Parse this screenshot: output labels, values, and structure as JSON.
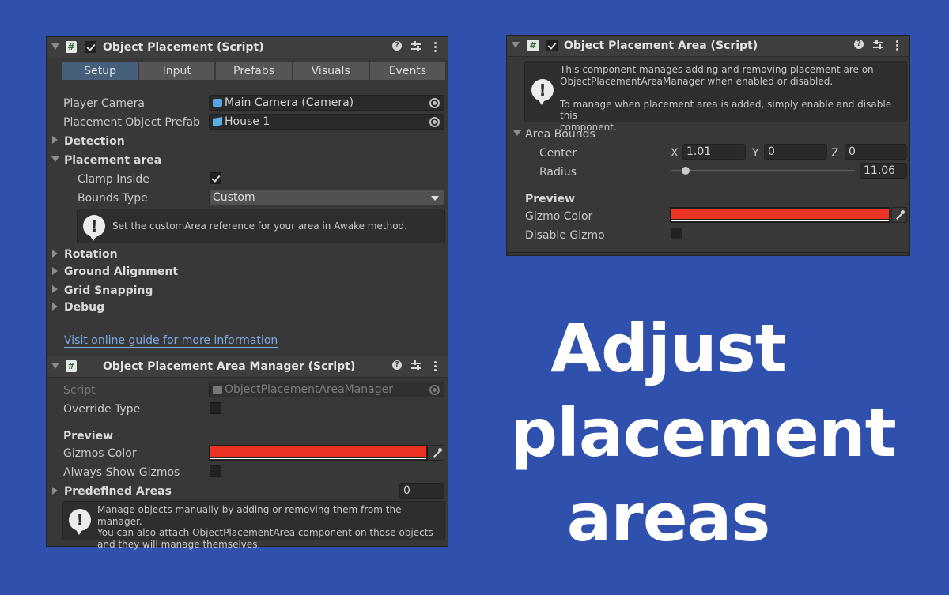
{
  "headline": {
    "line1": "Adjust",
    "line2": "placement",
    "line3": "areas"
  },
  "colors": {
    "background": "#2f50ad",
    "panel": "#383838",
    "gizmo_color": "#ea3323",
    "active_tab": "#46607c",
    "link": "#7fa7e6"
  },
  "left_panel": {
    "object_placement": {
      "title": "Object Placement (Script)",
      "script_icon": "#",
      "tabs": [
        {
          "label": "Setup",
          "active": true
        },
        {
          "label": "Input",
          "active": false
        },
        {
          "label": "Prefabs",
          "active": false
        },
        {
          "label": "Visuals",
          "active": false
        },
        {
          "label": "Events",
          "active": false
        }
      ],
      "player_camera_label": "Player Camera",
      "player_camera_value": "Main Camera (Camera)",
      "placement_prefab_label": "Placement Object Prefab",
      "placement_prefab_value": "House 1",
      "detection_label": "Detection",
      "placement_area_label": "Placement area",
      "clamp_inside_label": "Clamp Inside",
      "clamp_inside_checked": true,
      "bounds_type_label": "Bounds Type",
      "bounds_type_value": "Custom",
      "help_message": "Set the customArea reference for your area in Awake method.",
      "rotation_label": "Rotation",
      "ground_alignment_label": "Ground Alignment",
      "grid_snapping_label": "Grid Snapping",
      "debug_label": "Debug",
      "guide_link": "Visit online guide for more information"
    },
    "area_manager": {
      "title": "Object Placement Area Manager (Script)",
      "script_icon": "#",
      "script_label": "Script",
      "script_value": "ObjectPlacementAreaManager",
      "override_type_label": "Override Type",
      "preview_label": "Preview",
      "gizmos_color_label": "Gizmos Color",
      "always_show_gizmos_label": "Always Show Gizmos",
      "predefined_areas_label": "Predefined Areas",
      "predefined_areas_value": "0",
      "help_message": "Manage objects manually by adding or removing them from the manager.\nYou can also attach ObjectPlacementArea component on those objects\nand they will manage themselves."
    }
  },
  "right_panel": {
    "title": "Object Placement Area (Script)",
    "script_icon": "#",
    "help_message": "This component manages adding and removing placement are on\nObjectPlacementAreaManager when enabled or disabled.\n\nTo manage when placement area is added, simply enable and disable this\ncomponent.",
    "area_bounds_label": "Area Bounds",
    "center_label": "Center",
    "x_label": "X",
    "x_value": "1.01",
    "y_label": "Y",
    "y_value": "0",
    "z_label": "Z",
    "z_value": "0",
    "radius_label": "Radius",
    "radius_value": "11.06",
    "radius_slider_fraction": 0.08,
    "preview_label": "Preview",
    "gizmo_color_label": "Gizmo Color",
    "disable_gizmo_label": "Disable Gizmo"
  }
}
